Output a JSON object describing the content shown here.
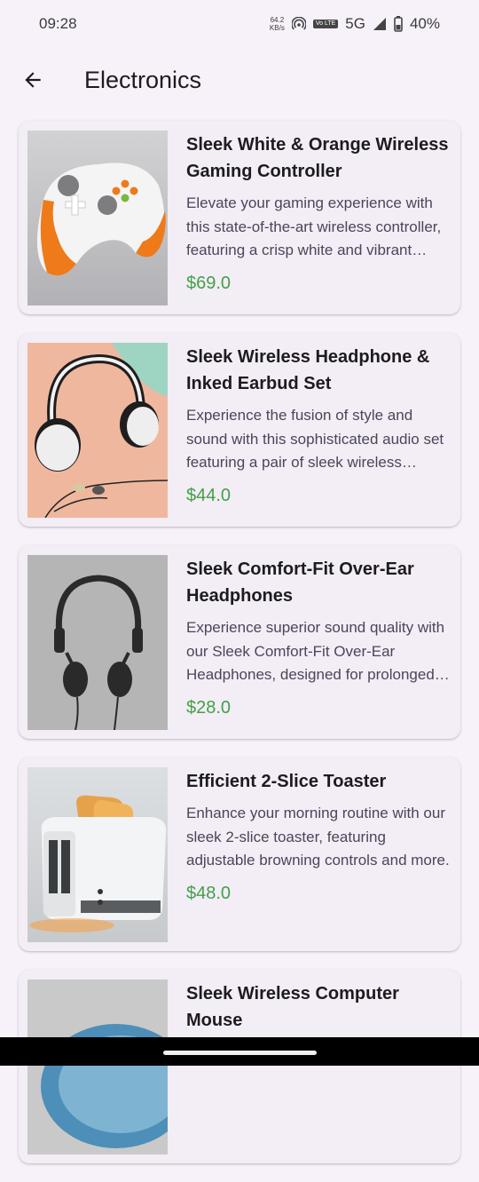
{
  "status": {
    "time": "09:28",
    "speed_value": "64.2",
    "speed_unit": "KB/s",
    "volte": "Vo LTE",
    "network": "5G",
    "battery": "40%"
  },
  "header": {
    "title": "Electronics",
    "back_icon": "arrow-back-icon"
  },
  "products": [
    {
      "name": "Sleek White & Orange Wireless Gaming Controller",
      "description": "Elevate your gaming experience with this state-of-the-art wireless controller, featuring a crisp white and vibrant orange design.",
      "price": "$69.0",
      "image": "game-controller"
    },
    {
      "name": "Sleek Wireless Headphone & Inked Earbud Set",
      "description": "Experience the fusion of style and sound with this sophisticated audio set featuring a pair of sleek wireless headphones.",
      "price": "$44.0",
      "image": "headphones-earbuds"
    },
    {
      "name": "Sleek Comfort-Fit Over-Ear Headphones",
      "description": "Experience superior sound quality with our Sleek Comfort-Fit Over-Ear Headphones, designed for prolonged listening comfort.",
      "price": "$28.0",
      "image": "over-ear-headphones"
    },
    {
      "name": "Efficient 2-Slice Toaster",
      "description": "Enhance your morning routine with our sleek 2-slice toaster, featuring adjustable browning controls and more.",
      "price": "$48.0",
      "image": "toaster"
    },
    {
      "name": "Sleek Wireless Computer Mouse",
      "description": "",
      "price": "",
      "image": "computer-mouse"
    }
  ],
  "colors": {
    "background": "#f7f2f9",
    "card": "#f3edf6",
    "price": "#43a047"
  }
}
